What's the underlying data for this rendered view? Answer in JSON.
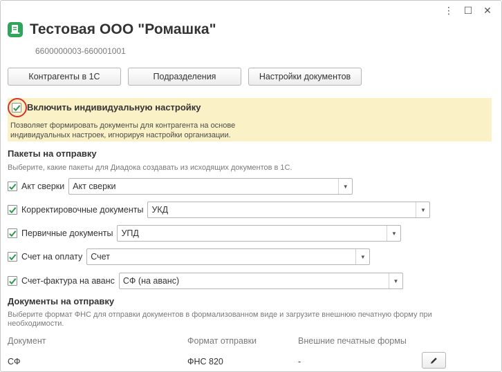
{
  "window": {
    "controls": {
      "menu": "⋮",
      "maximize": "☐",
      "close": "✕"
    }
  },
  "header": {
    "title": "Тестовая ООО \"Ромашка\"",
    "inn_kpp": "6600000003-660001001",
    "icon_color": "#2ea55a"
  },
  "toolbar": {
    "buttons": [
      "Контрагенты в 1С",
      "Подразделения",
      "Настройки документов"
    ]
  },
  "notice": {
    "checked": true,
    "title": "Включить индивидуальную настройку",
    "description": "Позволяет формировать документы для контрагента на основе индивидуальных настроек, игнорируя настройки организации.",
    "background": "#fbf1c6",
    "highlight_color": "#d9322e"
  },
  "packages": {
    "title": "Пакеты на отправку",
    "subtitle": "Выберите, какие пакеты для Диадока создавать из исходящих документов в 1С.",
    "items": [
      {
        "label": "Акт сверки",
        "value": "Акт сверки",
        "checked": true
      },
      {
        "label": "Корректировочные документы",
        "value": "УКД",
        "checked": true
      },
      {
        "label": "Первичные документы",
        "value": "УПД",
        "checked": true
      },
      {
        "label": "Счет на оплату",
        "value": "Счет",
        "checked": true
      },
      {
        "label": "Счет-фактура на аванс",
        "value": "СФ (на аванс)",
        "checked": true
      }
    ]
  },
  "documents": {
    "title": "Документы на отправку",
    "subtitle": "Выберите формат ФНС для отправки документов в формализованном виде и загрузите внешнюю печатную форму при необходимости.",
    "columns": [
      "Документ",
      "Формат отправки",
      "Внешние печатные формы"
    ],
    "rows": [
      {
        "doc": "СФ",
        "format": "ФНС 820",
        "print_form": "-"
      }
    ]
  },
  "accent_check_color": "#2e9a4e"
}
